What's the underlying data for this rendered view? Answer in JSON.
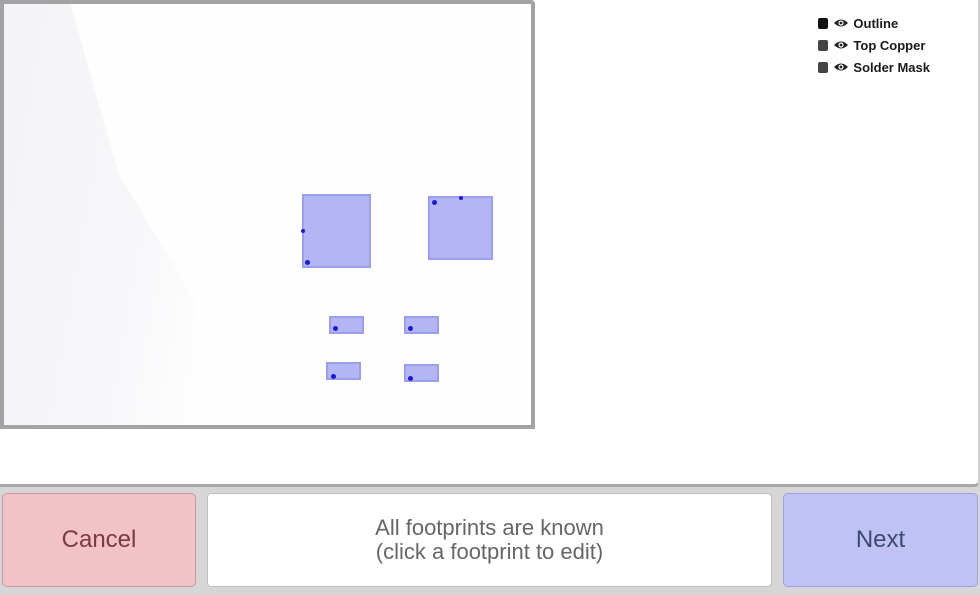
{
  "legend": {
    "layers": [
      {
        "label": "Outline",
        "swatch_color": "#111111",
        "visible": true
      },
      {
        "label": "Top Copper",
        "swatch_color": "#444444",
        "visible": true
      },
      {
        "label": "Solder Mask",
        "swatch_color": "#444444",
        "visible": true
      }
    ]
  },
  "board": {
    "pad_color": "#b3b5f5",
    "pin_marker_color": "#1a1ad8"
  },
  "footer": {
    "cancel_label": "Cancel",
    "status_line1": "All footprints are known",
    "status_line2": "(click a footprint to edit)",
    "next_label": "Next",
    "cancel_color": "#f2c3c6",
    "next_color": "#c0c2f5"
  }
}
